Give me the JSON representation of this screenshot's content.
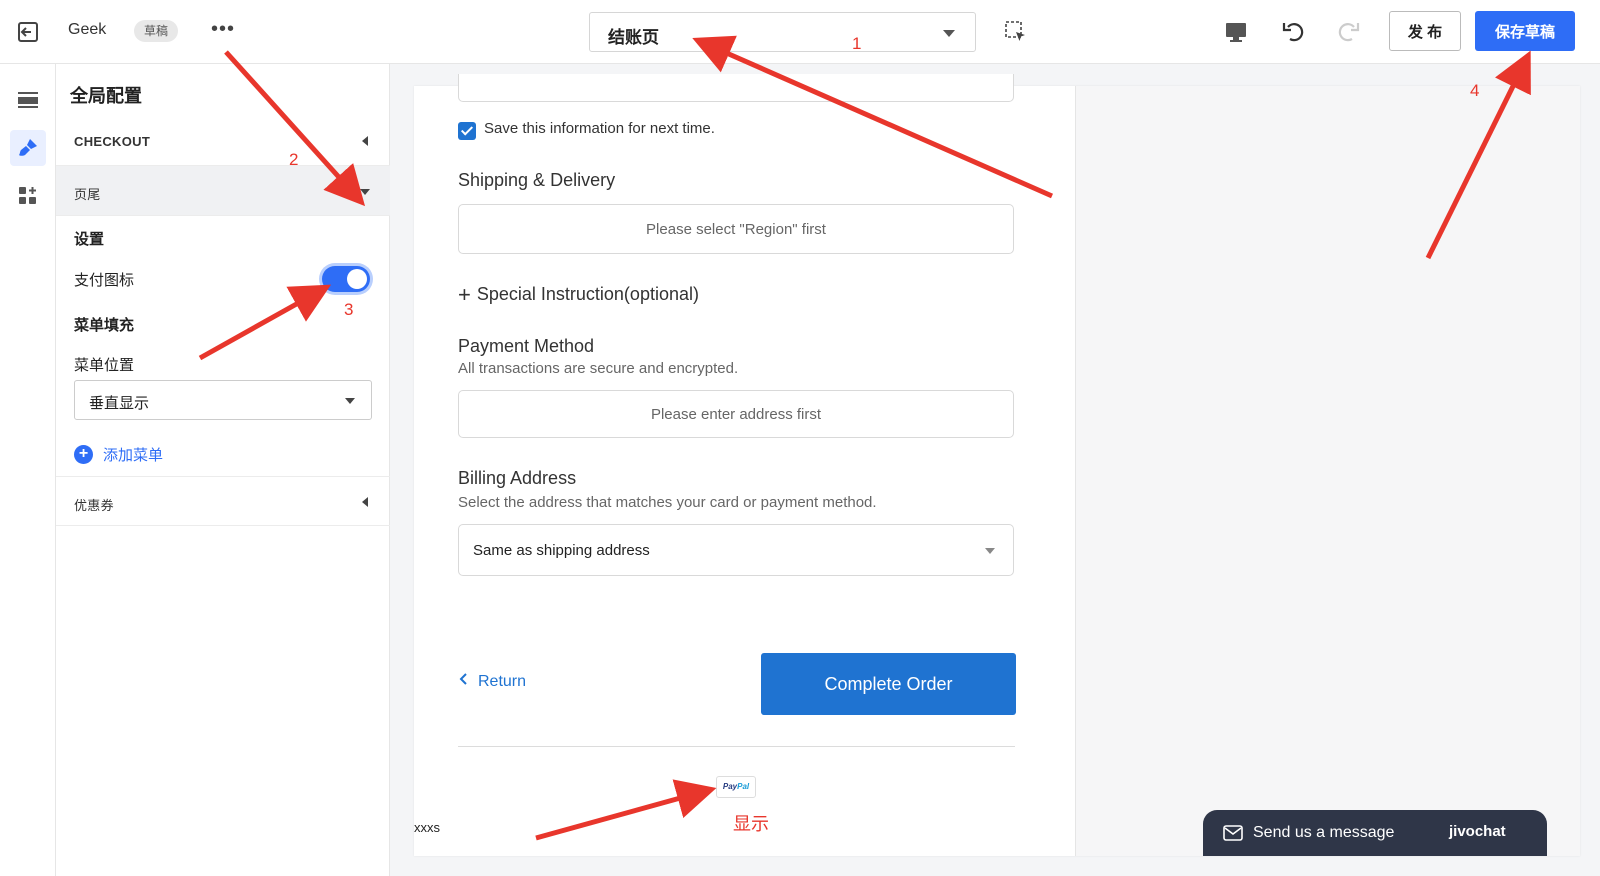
{
  "topbar": {
    "store_name": "Geek",
    "draft_badge": "草稿",
    "page_select": "结账页",
    "publish_label": "发 布",
    "save_draft_label": "保存草稿"
  },
  "panel": {
    "title": "全局配置",
    "sections": {
      "checkout": "CHECKOUT",
      "footer": "页尾",
      "coupon": "优惠券"
    },
    "settings_label": "设置",
    "payment_icons_label": "支付图标",
    "payment_icons_on": true,
    "menu_fill_label": "菜单填充",
    "menu_position_label": "菜单位置",
    "menu_position_value": "垂直显示",
    "add_menu_label": "添加菜单"
  },
  "checkout": {
    "save_info_label": "Save this information for next time.",
    "shipping_heading": "Shipping & Delivery",
    "shipping_placeholder": "Please select \"Region\" first",
    "special_instruction": "Special Instruction(optional)",
    "payment_heading": "Payment Method",
    "payment_sub": "All transactions are secure and encrypted.",
    "payment_placeholder": "Please enter address first",
    "billing_heading": "Billing Address",
    "billing_sub": "Select the address that matches your card or payment method.",
    "billing_value": "Same as shipping address",
    "return_label": "Return",
    "complete_label": "Complete Order",
    "paypal_part1": "Pay",
    "paypal_part2": "Pal",
    "footer_text": "xxxs"
  },
  "chat": {
    "message": "Send us a message",
    "brand": "jivochat"
  },
  "annotations": {
    "n1": "1",
    "n2": "2",
    "n3": "3",
    "n4": "4",
    "shown": "显示"
  },
  "colors": {
    "primary": "#2e6df6",
    "checkout_blue": "#1f73d1",
    "annotation_red": "#e8362c",
    "chat_bg": "#2f3648"
  }
}
